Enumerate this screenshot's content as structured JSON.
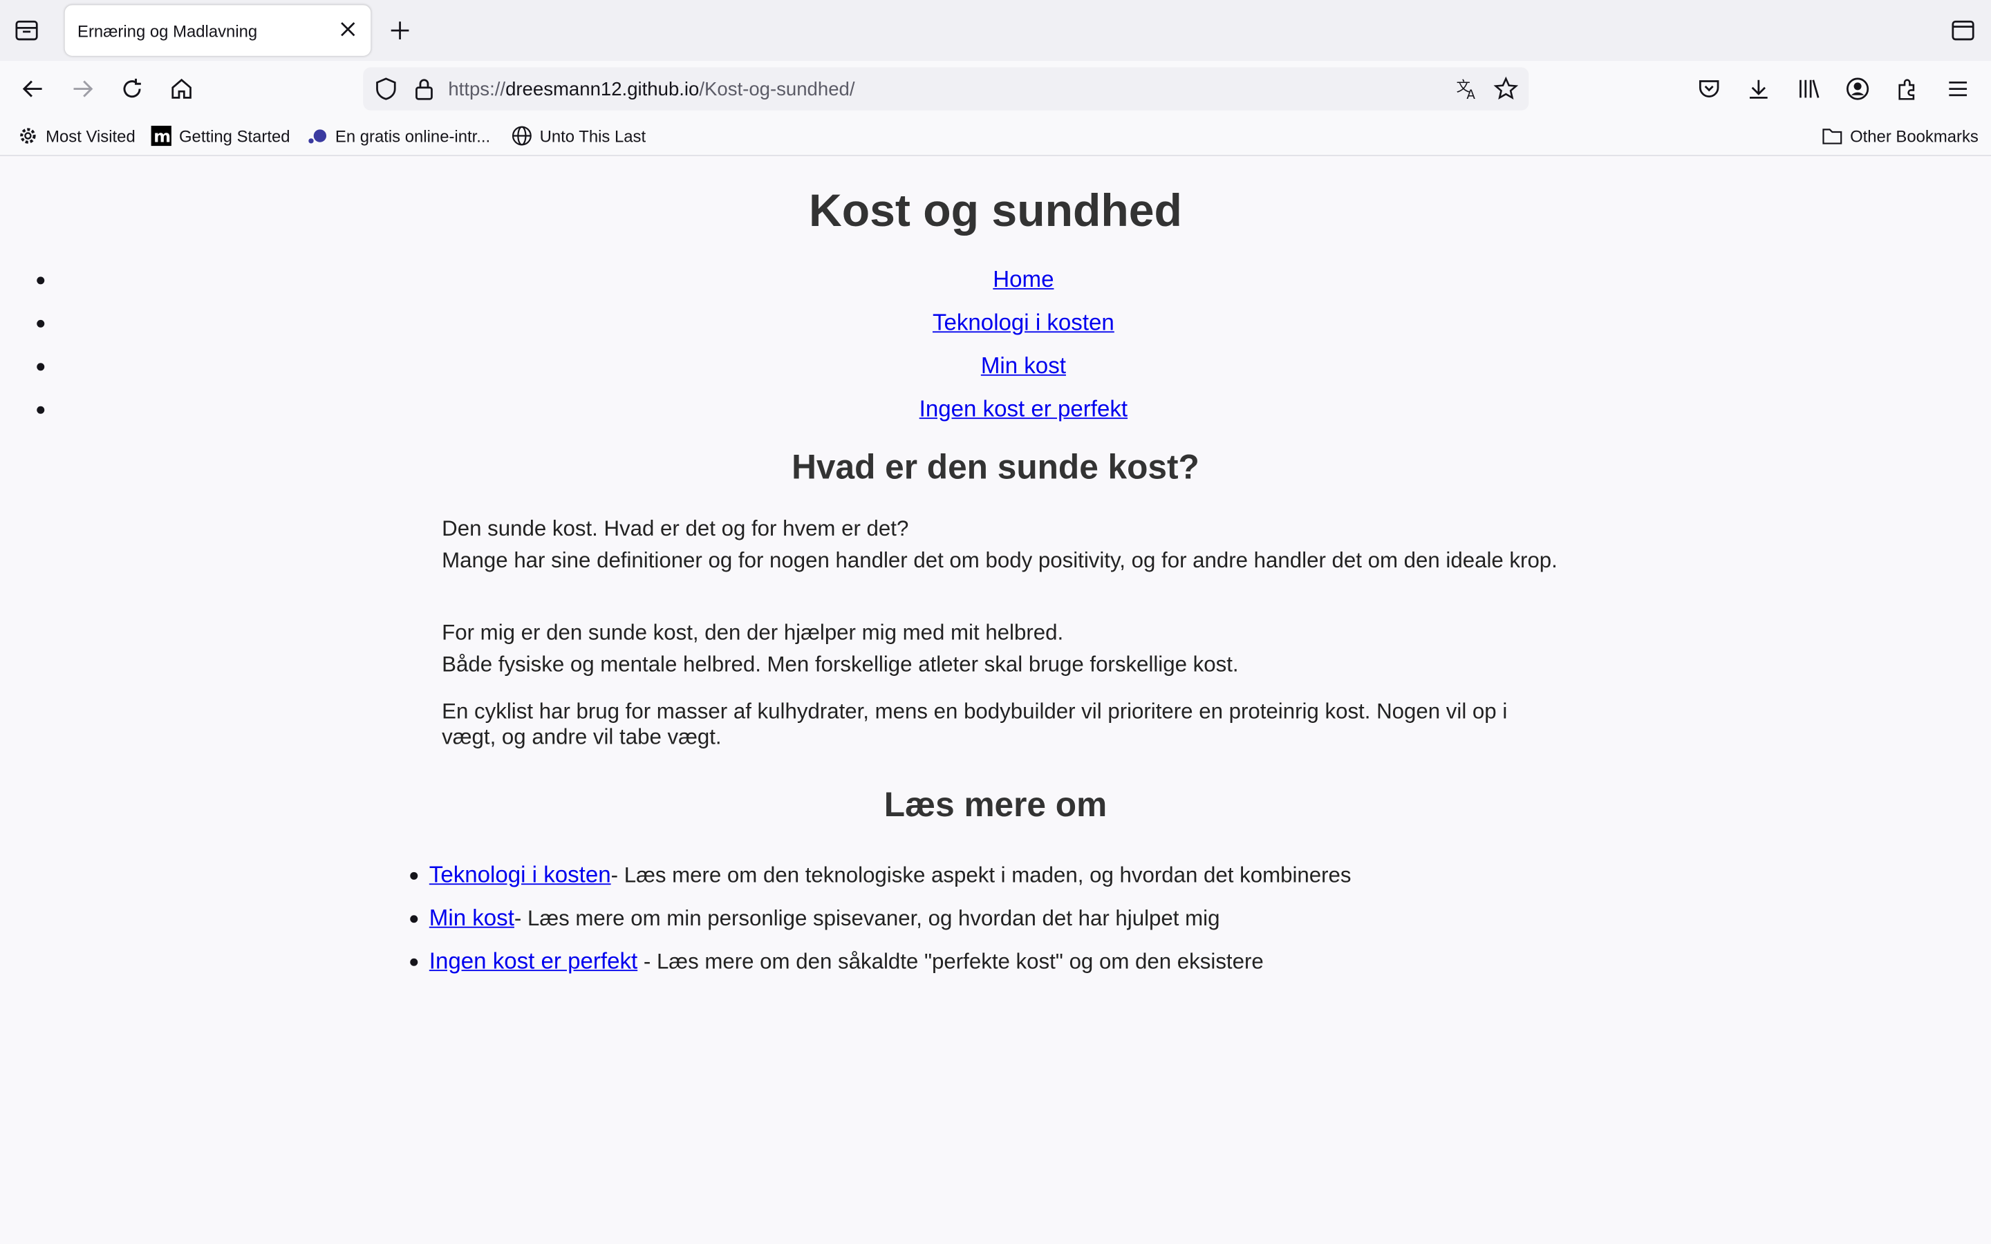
{
  "browser": {
    "tab_title": "Ernæring og Madlavning",
    "url_scheme": "https://",
    "url_host": "dreesmann12.github.io",
    "url_path": "/Kost-og-sundhed/",
    "bookmarks": [
      "Most Visited",
      "Getting Started",
      "En gratis online-intr...",
      "Unto This Last"
    ],
    "other_bookmarks": "Other Bookmarks"
  },
  "page": {
    "title": "Kost og sundhed",
    "nav": [
      "Home",
      "Teknologi i kosten",
      "Min kost",
      "Ingen kost er perfekt"
    ],
    "section_heading": "Hvad er den sunde kost?",
    "paragraphs": [
      [
        "Den sunde kost. Hvad er det og for hvem er det?",
        "Mange har sine definitioner og for nogen handler det om body positivity, og for andre handler det om den ideale krop."
      ],
      [
        "For mig er den sunde kost, den der hjælper mig med mit helbred.",
        "Både fysiske og mentale helbred. Men forskellige atleter skal bruge forskellige kost."
      ],
      [
        "En cyklist har brug for masser af kulhydrater, mens en bodybuilder vil prioritere en proteinrig kost. Nogen vil op i vægt, og andre vil tabe vægt."
      ]
    ],
    "more_heading": "Læs mere om",
    "more_items": [
      {
        "link": "Teknologi i kosten",
        "text": "- Læs mere om den teknologiske aspekt i maden, og hvordan det kombineres"
      },
      {
        "link": "Min kost",
        "text": "- Læs mere om min personlige spisevaner, og hvordan det har hjulpet mig"
      },
      {
        "link": "Ingen kost er perfekt",
        "text": " - Læs mere om den såkaldte \"perfekte kost\" og om den eksistere"
      }
    ]
  }
}
